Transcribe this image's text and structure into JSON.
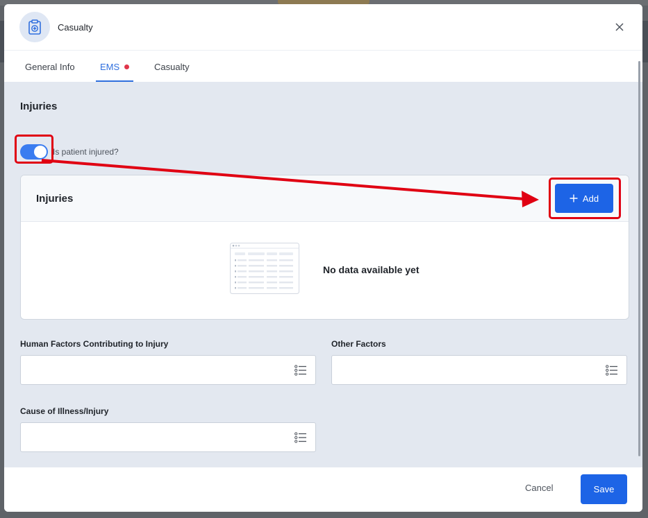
{
  "modal": {
    "title": "Casualty",
    "header_icon": "clipboard-medical-icon",
    "close_icon": "close-icon"
  },
  "tabs": [
    {
      "label": "General Info",
      "active": false
    },
    {
      "label": "EMS",
      "active": true,
      "has_alert_dot": true
    },
    {
      "label": "Casualty",
      "active": false
    }
  ],
  "section": {
    "title": "Injuries",
    "toggle": {
      "label": "Is patient injured?",
      "checked": true
    }
  },
  "injuries_card": {
    "title": "Injuries",
    "add_label": "Add",
    "add_icon": "plus-icon",
    "empty_message": "No data available yet",
    "empty_icon": "empty-table-illustration-icon"
  },
  "fields": {
    "human_factors": {
      "label": "Human Factors Contributing to Injury",
      "value": ""
    },
    "other_factors": {
      "label": "Other Factors",
      "value": ""
    },
    "cause": {
      "label": "Cause of Illness/Injury",
      "value": ""
    },
    "list_icon": "list-icon"
  },
  "footer": {
    "cancel_label": "Cancel",
    "save_label": "Save"
  },
  "colors": {
    "primary": "#1d64e6",
    "toggle_on": "#3a7cf0",
    "alert_dot": "#e0364a",
    "annotation": "#e00012",
    "body_bg": "#e3e8f0"
  }
}
